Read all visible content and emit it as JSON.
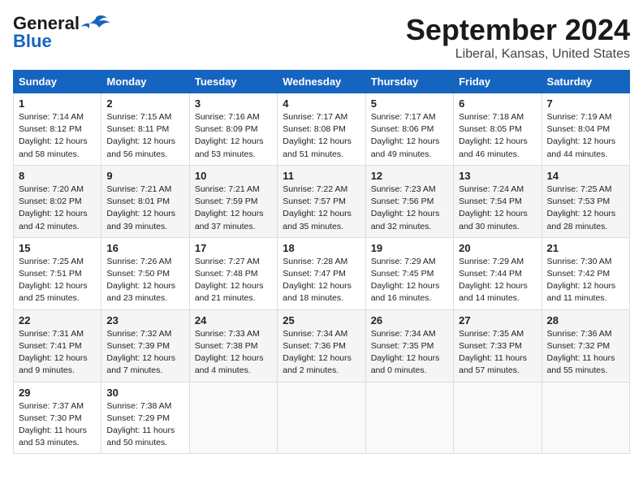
{
  "logo": {
    "line1": "General",
    "line2": "Blue"
  },
  "title": "September 2024",
  "location": "Liberal, Kansas, United States",
  "weekdays": [
    "Sunday",
    "Monday",
    "Tuesday",
    "Wednesday",
    "Thursday",
    "Friday",
    "Saturday"
  ],
  "weeks": [
    [
      {
        "day": "1",
        "lines": [
          "Sunrise: 7:14 AM",
          "Sunset: 8:12 PM",
          "Daylight: 12 hours",
          "and 58 minutes."
        ]
      },
      {
        "day": "2",
        "lines": [
          "Sunrise: 7:15 AM",
          "Sunset: 8:11 PM",
          "Daylight: 12 hours",
          "and 56 minutes."
        ]
      },
      {
        "day": "3",
        "lines": [
          "Sunrise: 7:16 AM",
          "Sunset: 8:09 PM",
          "Daylight: 12 hours",
          "and 53 minutes."
        ]
      },
      {
        "day": "4",
        "lines": [
          "Sunrise: 7:17 AM",
          "Sunset: 8:08 PM",
          "Daylight: 12 hours",
          "and 51 minutes."
        ]
      },
      {
        "day": "5",
        "lines": [
          "Sunrise: 7:17 AM",
          "Sunset: 8:06 PM",
          "Daylight: 12 hours",
          "and 49 minutes."
        ]
      },
      {
        "day": "6",
        "lines": [
          "Sunrise: 7:18 AM",
          "Sunset: 8:05 PM",
          "Daylight: 12 hours",
          "and 46 minutes."
        ]
      },
      {
        "day": "7",
        "lines": [
          "Sunrise: 7:19 AM",
          "Sunset: 8:04 PM",
          "Daylight: 12 hours",
          "and 44 minutes."
        ]
      }
    ],
    [
      {
        "day": "8",
        "lines": [
          "Sunrise: 7:20 AM",
          "Sunset: 8:02 PM",
          "Daylight: 12 hours",
          "and 42 minutes."
        ]
      },
      {
        "day": "9",
        "lines": [
          "Sunrise: 7:21 AM",
          "Sunset: 8:01 PM",
          "Daylight: 12 hours",
          "and 39 minutes."
        ]
      },
      {
        "day": "10",
        "lines": [
          "Sunrise: 7:21 AM",
          "Sunset: 7:59 PM",
          "Daylight: 12 hours",
          "and 37 minutes."
        ]
      },
      {
        "day": "11",
        "lines": [
          "Sunrise: 7:22 AM",
          "Sunset: 7:57 PM",
          "Daylight: 12 hours",
          "and 35 minutes."
        ]
      },
      {
        "day": "12",
        "lines": [
          "Sunrise: 7:23 AM",
          "Sunset: 7:56 PM",
          "Daylight: 12 hours",
          "and 32 minutes."
        ]
      },
      {
        "day": "13",
        "lines": [
          "Sunrise: 7:24 AM",
          "Sunset: 7:54 PM",
          "Daylight: 12 hours",
          "and 30 minutes."
        ]
      },
      {
        "day": "14",
        "lines": [
          "Sunrise: 7:25 AM",
          "Sunset: 7:53 PM",
          "Daylight: 12 hours",
          "and 28 minutes."
        ]
      }
    ],
    [
      {
        "day": "15",
        "lines": [
          "Sunrise: 7:25 AM",
          "Sunset: 7:51 PM",
          "Daylight: 12 hours",
          "and 25 minutes."
        ]
      },
      {
        "day": "16",
        "lines": [
          "Sunrise: 7:26 AM",
          "Sunset: 7:50 PM",
          "Daylight: 12 hours",
          "and 23 minutes."
        ]
      },
      {
        "day": "17",
        "lines": [
          "Sunrise: 7:27 AM",
          "Sunset: 7:48 PM",
          "Daylight: 12 hours",
          "and 21 minutes."
        ]
      },
      {
        "day": "18",
        "lines": [
          "Sunrise: 7:28 AM",
          "Sunset: 7:47 PM",
          "Daylight: 12 hours",
          "and 18 minutes."
        ]
      },
      {
        "day": "19",
        "lines": [
          "Sunrise: 7:29 AM",
          "Sunset: 7:45 PM",
          "Daylight: 12 hours",
          "and 16 minutes."
        ]
      },
      {
        "day": "20",
        "lines": [
          "Sunrise: 7:29 AM",
          "Sunset: 7:44 PM",
          "Daylight: 12 hours",
          "and 14 minutes."
        ]
      },
      {
        "day": "21",
        "lines": [
          "Sunrise: 7:30 AM",
          "Sunset: 7:42 PM",
          "Daylight: 12 hours",
          "and 11 minutes."
        ]
      }
    ],
    [
      {
        "day": "22",
        "lines": [
          "Sunrise: 7:31 AM",
          "Sunset: 7:41 PM",
          "Daylight: 12 hours",
          "and 9 minutes."
        ]
      },
      {
        "day": "23",
        "lines": [
          "Sunrise: 7:32 AM",
          "Sunset: 7:39 PM",
          "Daylight: 12 hours",
          "and 7 minutes."
        ]
      },
      {
        "day": "24",
        "lines": [
          "Sunrise: 7:33 AM",
          "Sunset: 7:38 PM",
          "Daylight: 12 hours",
          "and 4 minutes."
        ]
      },
      {
        "day": "25",
        "lines": [
          "Sunrise: 7:34 AM",
          "Sunset: 7:36 PM",
          "Daylight: 12 hours",
          "and 2 minutes."
        ]
      },
      {
        "day": "26",
        "lines": [
          "Sunrise: 7:34 AM",
          "Sunset: 7:35 PM",
          "Daylight: 12 hours",
          "and 0 minutes."
        ]
      },
      {
        "day": "27",
        "lines": [
          "Sunrise: 7:35 AM",
          "Sunset: 7:33 PM",
          "Daylight: 11 hours",
          "and 57 minutes."
        ]
      },
      {
        "day": "28",
        "lines": [
          "Sunrise: 7:36 AM",
          "Sunset: 7:32 PM",
          "Daylight: 11 hours",
          "and 55 minutes."
        ]
      }
    ],
    [
      {
        "day": "29",
        "lines": [
          "Sunrise: 7:37 AM",
          "Sunset: 7:30 PM",
          "Daylight: 11 hours",
          "and 53 minutes."
        ]
      },
      {
        "day": "30",
        "lines": [
          "Sunrise: 7:38 AM",
          "Sunset: 7:29 PM",
          "Daylight: 11 hours",
          "and 50 minutes."
        ]
      },
      {
        "day": "",
        "lines": []
      },
      {
        "day": "",
        "lines": []
      },
      {
        "day": "",
        "lines": []
      },
      {
        "day": "",
        "lines": []
      },
      {
        "day": "",
        "lines": []
      }
    ]
  ]
}
